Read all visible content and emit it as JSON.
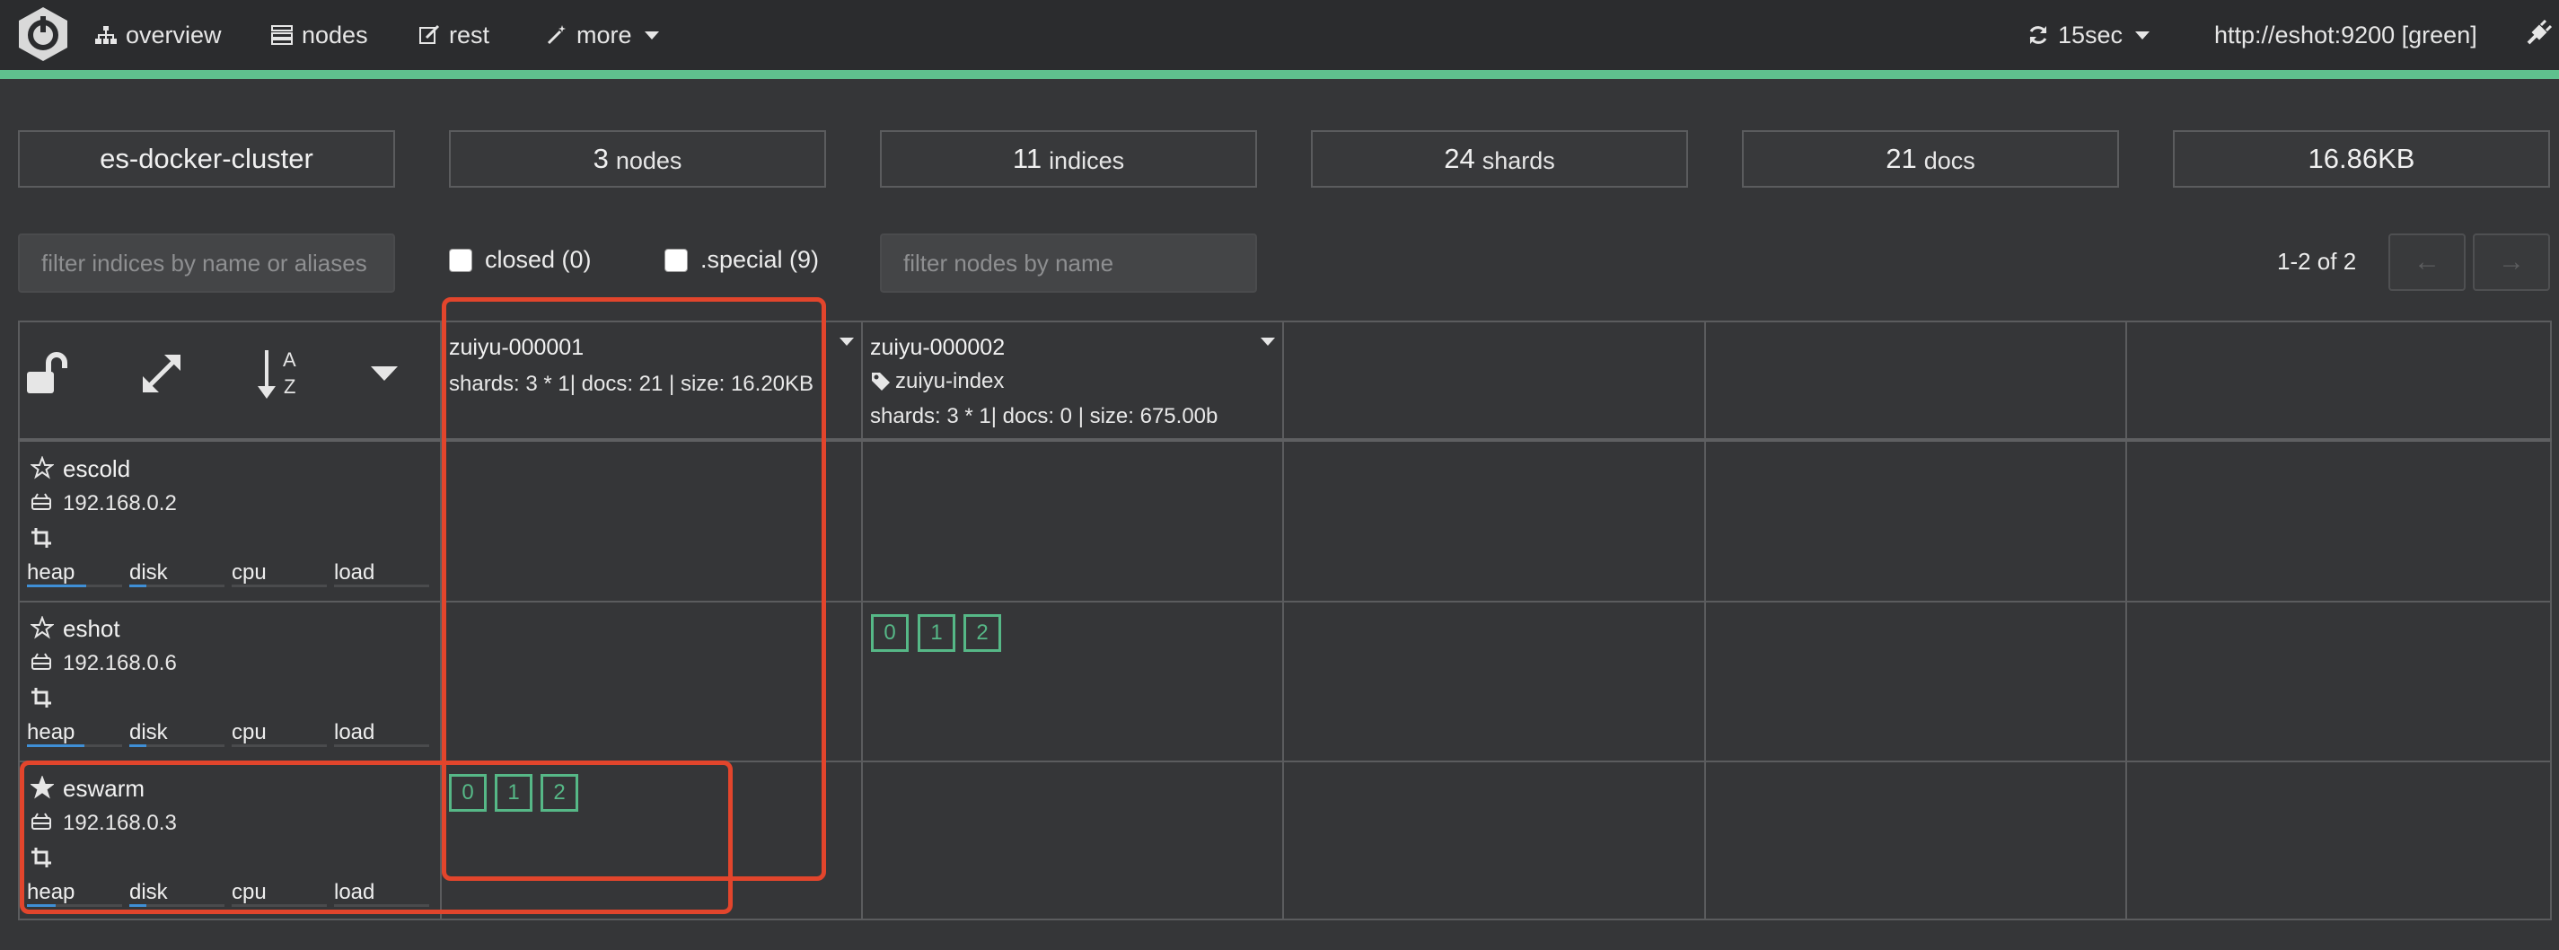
{
  "nav": {
    "overview": "overview",
    "nodes": "nodes",
    "rest": "rest",
    "more": "more",
    "refresh": "15sec",
    "connection": "http://eshot:9200 [green]"
  },
  "stats": {
    "cluster_name": "es-docker-cluster",
    "nodes_count": "3",
    "nodes_label": "nodes",
    "indices_count": "11",
    "indices_label": "indices",
    "shards_count": "24",
    "shards_label": "shards",
    "docs_count": "21",
    "docs_label": "docs",
    "size": "16.86KB"
  },
  "filters": {
    "indices_placeholder": "filter indices by name or aliases",
    "closed_label": "closed (0)",
    "special_label": ".special (9)",
    "nodes_placeholder": "filter nodes by name",
    "pager_text": "1-2 of 2",
    "prev": "←",
    "next": "→"
  },
  "indices": [
    {
      "name": "zuiyu-000001",
      "meta": "shards: 3 * 1| docs: 21 | size: 16.20KB"
    },
    {
      "name": "zuiyu-000002",
      "alias": "zuiyu-index",
      "meta": "shards: 3 * 1| docs: 0 | size: 675.00b"
    }
  ],
  "nodes": [
    {
      "name": "escold",
      "ip": "192.168.0.2",
      "master": false,
      "heap_fraction": 0.62,
      "disk_fraction": 0.18,
      "shards": []
    },
    {
      "name": "eshot",
      "ip": "192.168.0.6",
      "master": false,
      "heap_fraction": 0.6,
      "disk_fraction": 0.18,
      "shards": [
        "0",
        "1",
        "2"
      ]
    },
    {
      "name": "eswarm",
      "ip": "192.168.0.3",
      "master": true,
      "heap_fraction": 0.3,
      "disk_fraction": 0.18,
      "shards": [
        "0",
        "1",
        "2"
      ]
    }
  ],
  "metric_labels": {
    "heap": "heap",
    "disk": "disk",
    "cpu": "cpu",
    "load": "load"
  },
  "colors": {
    "accent_bar": "#5fc08e",
    "shard": "#56b887",
    "highlight": "#e2452c",
    "metric_fill": "#3f8fd6"
  }
}
